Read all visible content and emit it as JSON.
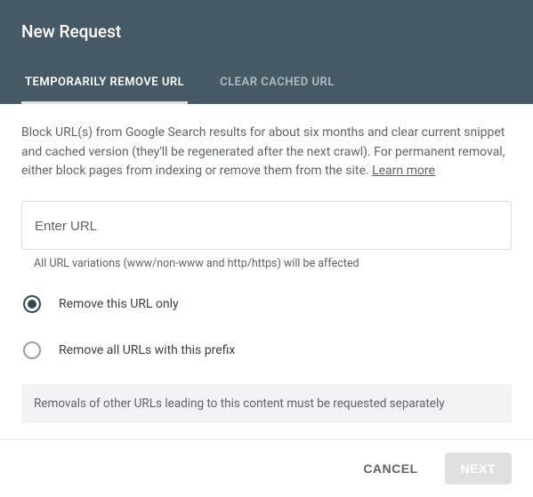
{
  "header": {
    "title": "New Request",
    "tabs": [
      {
        "label": "TEMPORARILY REMOVE URL",
        "active": true
      },
      {
        "label": "CLEAR CACHED URL",
        "active": false
      }
    ]
  },
  "content": {
    "description": "Block URL(s) from Google Search results for about six months and clear current snippet and cached version (they'll be regenerated after the next crawl). For permanent removal, either block pages from indexing or remove them from the site. ",
    "learn_more": "Learn more",
    "url_input": {
      "placeholder": "Enter URL",
      "value": ""
    },
    "helper_text": "All URL variations (www/non-www and http/https) will be affected",
    "radio_options": [
      {
        "label": "Remove this URL only",
        "checked": true
      },
      {
        "label": "Remove all URLs with this prefix",
        "checked": false
      }
    ],
    "info_bar": "Removals of other URLs leading to this content must be requested separately"
  },
  "footer": {
    "cancel": "CANCEL",
    "next": "NEXT"
  }
}
